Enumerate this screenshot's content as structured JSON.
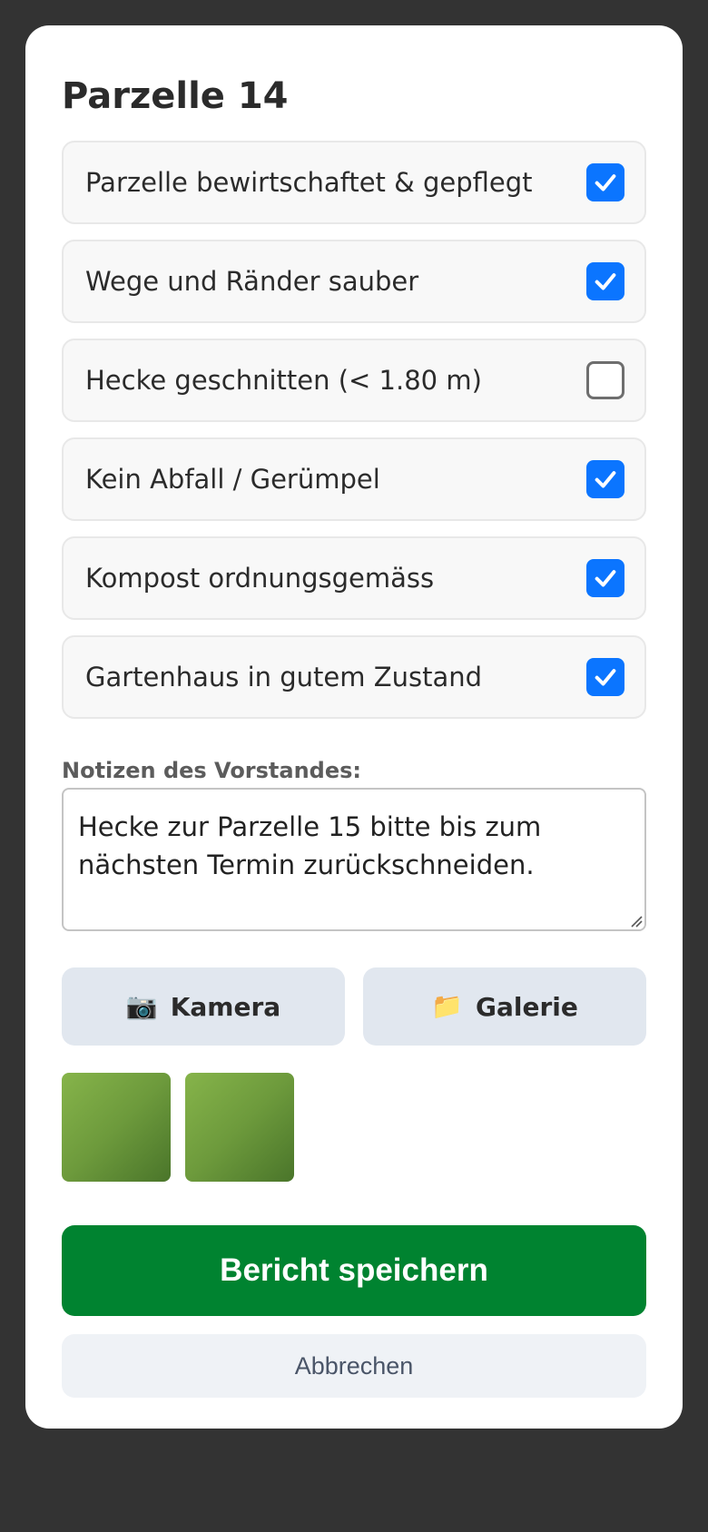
{
  "modal": {
    "title": "Parzelle 14"
  },
  "checklist": [
    {
      "label": "Parzelle bewirtschaftet & gepflegt",
      "checked": true
    },
    {
      "label": "Wege und Ränder sauber",
      "checked": true
    },
    {
      "label": "Hecke geschnitten (< 1.80 m)",
      "checked": false
    },
    {
      "label": "Kein Abfall / Gerümpel",
      "checked": true
    },
    {
      "label": "Kompost ordnungsgemäss",
      "checked": true
    },
    {
      "label": "Gartenhaus in gutem Zustand",
      "checked": true
    }
  ],
  "notes": {
    "label": "Notizen des Vorstandes:",
    "value": "Hecke zur Parzelle 15 bitte bis zum nächsten Termin zurückschneiden."
  },
  "media": {
    "camera_icon": "camera-icon",
    "camera_glyph": "📷",
    "camera_label": "Kamera",
    "gallery_icon": "folder-icon",
    "gallery_glyph": "📁",
    "gallery_label": "Galerie",
    "photo_count": 2
  },
  "actions": {
    "save_label": "Bericht speichern",
    "cancel_label": "Abbrechen"
  },
  "colors": {
    "backdrop": "#333333",
    "checkbox_checked": "#0b75ff",
    "save_button": "#008330",
    "media_button": "#e1e7ef"
  }
}
